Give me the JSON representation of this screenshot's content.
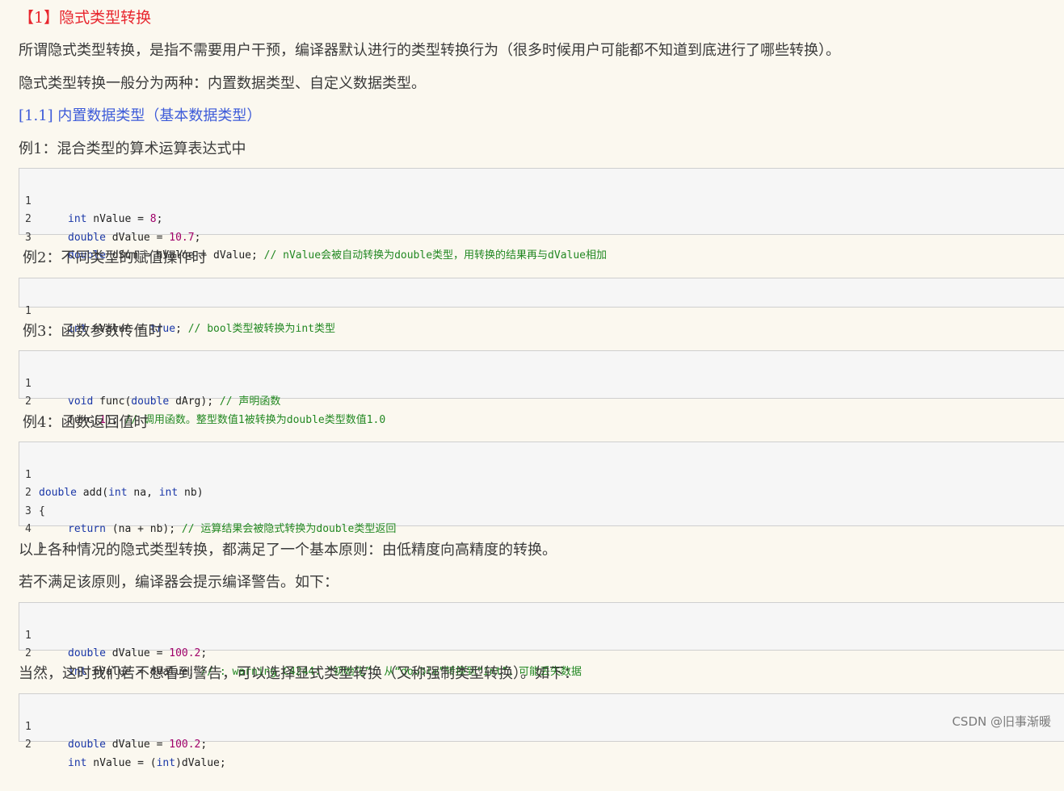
{
  "heading": "【1】隐式类型转换",
  "intro_1": "所谓隐式类型转换，是指不需要用户干预，编译器默认进行的类型转换行为（很多时候用户可能都不知道到底进行了哪些转换）。",
  "intro_2": "隐式类型转换一般分为两种：内置数据类型、自定义数据类型。",
  "subheading": "[1.1] 内置数据类型（基本数据类型）",
  "example_1": {
    "title": "例1：混合类型的算术运算表达式中",
    "lines": [
      {
        "n": "1",
        "type": "int",
        "rest": " nValue = ",
        "num": "8",
        "end": ";"
      },
      {
        "n": "2",
        "type": "double",
        "rest": " dValue = ",
        "num": "10.7",
        "end": ";"
      },
      {
        "n": "3",
        "type": "double",
        "rest": " dSum = nValue + dValue; ",
        "comment": "// nValue会被自动转换为double类型，用转换的结果再与dValue相加"
      }
    ]
  },
  "example_2": {
    "title": "例2：不同类型的赋值操作时",
    "lines": [
      {
        "n": "1",
        "type": "int",
        "rest": " nValue = ",
        "kw2": "true",
        "end": "; ",
        "comment": "// bool类型被转换为int类型"
      }
    ]
  },
  "example_3": {
    "title": "例3：函数参数传值时",
    "lines": [
      {
        "n": "1",
        "type": "void",
        "pre": " func(",
        "type2": "double",
        "rest": " dArg); ",
        "comment": "// 声明函数"
      },
      {
        "n": "2",
        "pre": "func(",
        "num": "1",
        "rest": "); ",
        "comment": "// 调用函数。整型数值1被转换为double类型数值1.0"
      }
    ]
  },
  "example_4": {
    "title": "例4：函数返回值时",
    "lines": [
      {
        "n": "1",
        "type": "double",
        "pre": " add(",
        "type2": "int",
        "mid": " na, ",
        "type3": "int",
        "rest": " nb)"
      },
      {
        "n": "2",
        "text": "{"
      },
      {
        "n": "3",
        "type": "return",
        "rest": " (na + nb); ",
        "comment": "// 运算结果会被隐式转换为double类型返回"
      },
      {
        "n": "4",
        "text": "}"
      }
    ]
  },
  "summary_1": "以上各种情况的隐式类型转换，都满足了一个基本原则：由低精度向高精度的转换。",
  "summary_2": "若不满足该原则，编译器会提示编译警告。如下：",
  "example_5": {
    "lines": [
      {
        "n": "1",
        "type": "double",
        "rest": " dValue = ",
        "num": "100.2",
        "end": ";"
      },
      {
        "n": "2",
        "type": "int",
        "rest": " nValue = dValue; ",
        "comment": "// : warning C4244: “初始化”: 从“double”转换到“int”，可能丢失数据"
      }
    ]
  },
  "summary_3": "当然，这时我们若不想看到警告，可以选择显式类型转换（又称强制类型转换）。如下：",
  "example_6": {
    "lines": [
      {
        "n": "1",
        "type": "double",
        "rest": " dValue = ",
        "num": "100.2",
        "end": ";"
      },
      {
        "n": "2",
        "type": "int",
        "pre": " nValue = (",
        "type2": "int",
        "rest": ")dValue;"
      }
    ]
  },
  "watermark": "CSDN @旧事渐暖"
}
